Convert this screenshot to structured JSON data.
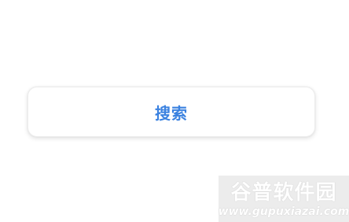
{
  "search_button": {
    "label": "搜索",
    "color": "#3b82e0"
  },
  "watermark": {
    "title": "谷普软件园",
    "url": "www.gupuxiazai.com"
  }
}
